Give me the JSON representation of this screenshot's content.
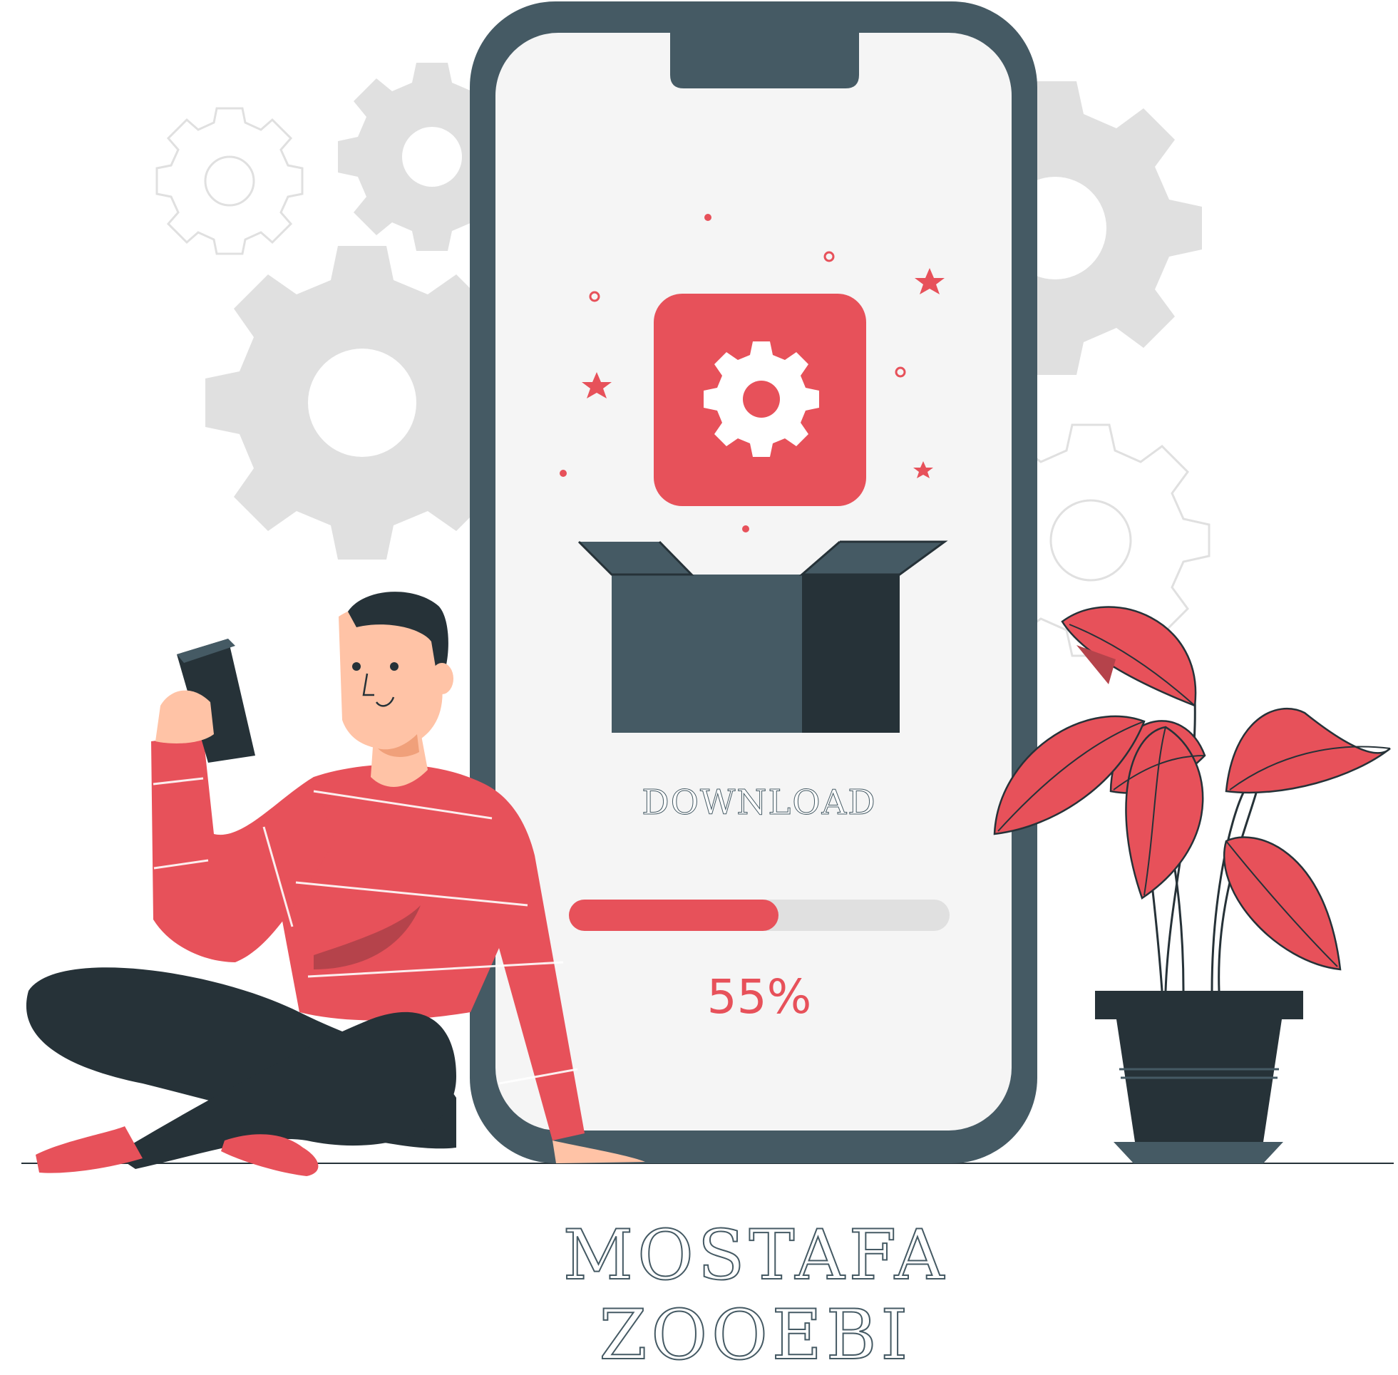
{
  "screen": {
    "label": "DOWNLOAD",
    "progress_text": "55%",
    "progress_fraction": 0.55
  },
  "signature": "MOSTAFA ZOOEBI",
  "icons": {
    "app": "gear-icon",
    "box": "open-box-icon",
    "background": "gears"
  },
  "colors": {
    "accent": "#e7515a",
    "dark": "#263238",
    "phone": "#455a64",
    "gear_gray": "#e0e0e0",
    "track": "#e0e0e0",
    "skin": "#ffc3a6"
  }
}
